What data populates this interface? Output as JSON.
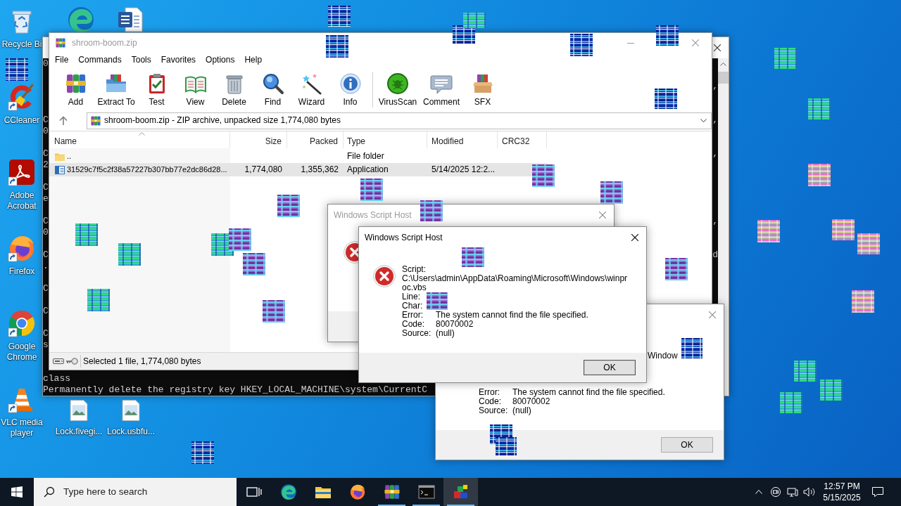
{
  "desktop": {
    "shortcuts": [
      {
        "kind": "recycle-bin",
        "label": "Recycle Bi",
        "shortcut": false
      },
      {
        "kind": "browser",
        "shortcut": false
      },
      {
        "kind": "document",
        "shortcut": false
      },
      {
        "kind": "cleaner",
        "label": "CCleaner",
        "shortcut": true
      },
      {
        "kind": "pdf",
        "label": "Adobe Acrobat",
        "shortcut": true
      },
      {
        "kind": "firefox",
        "label": "Firefox",
        "shortcut": true
      },
      {
        "kind": "chrome",
        "label": "Google Chrome",
        "shortcut": true
      },
      {
        "kind": "vlc",
        "label": "VLC media player",
        "shortcut": true
      },
      {
        "kind": "image",
        "label": "Lock.fivegi...",
        "shortcut": false
      },
      {
        "kind": "image",
        "label": "Lock.usbfu...",
        "shortcut": false
      }
    ]
  },
  "console": {
    "left_fragments": [
      "0",
      "C",
      "0",
      "C",
      "2",
      "C",
      "e",
      "C",
      "0",
      "C",
      ".",
      "C",
      "C",
      "C",
      "s"
    ],
    "right_fragments": [
      ",",
      ",",
      ",",
      ",",
      "d"
    ],
    "lines": [
      "class",
      "Permanently delete the registry key HKEY_LOCAL_MACHINE\\system\\CurrentC"
    ]
  },
  "winrar": {
    "title": "shroom-boom.zip",
    "active": false,
    "menu": [
      "File",
      "Commands",
      "Tools",
      "Favorites",
      "Options",
      "Help"
    ],
    "toolbar": [
      {
        "kind": "add",
        "label": "Add"
      },
      {
        "kind": "extract",
        "label": "Extract To"
      },
      {
        "kind": "test",
        "label": "Test"
      },
      {
        "kind": "view",
        "label": "View"
      },
      {
        "kind": "delete",
        "label": "Delete"
      },
      {
        "kind": "find",
        "label": "Find"
      },
      {
        "kind": "wizard",
        "label": "Wizard"
      },
      {
        "kind": "info",
        "label": "Info"
      },
      {
        "kind": "separator"
      },
      {
        "kind": "virusscan",
        "label": "VirusScan"
      },
      {
        "kind": "comment",
        "label": "Comment"
      },
      {
        "kind": "sfx",
        "label": "SFX"
      }
    ],
    "address": "shroom-boom.zip - ZIP archive, unpacked size 1,774,080 bytes",
    "columns": [
      {
        "label": "Name",
        "sorted": true
      },
      {
        "label": "Size",
        "sorted": false
      },
      {
        "label": "Packed",
        "sorted": false
      },
      {
        "label": "Type",
        "sorted": false
      },
      {
        "label": "Modified",
        "sorted": false
      },
      {
        "label": "CRC32",
        "sorted": false
      }
    ],
    "rows": [
      {
        "kind": "folder",
        "name": "..",
        "type": "File folder",
        "selected": false
      },
      {
        "kind": "application",
        "name": "31529c7f5c2f38a57227b307bb77e2dc86d28...",
        "size": "1,774,080",
        "packed": "1,355,362",
        "type": "Application",
        "modified": "5/14/2025 12:2...",
        "selected": true
      }
    ],
    "status": "Selected 1 file, 1,774,080 bytes"
  },
  "script_error_dialogs": [
    {
      "title": "Windows Script Host",
      "active": false
    },
    {
      "title": "Windows Script Host",
      "active": true,
      "lines": [
        {
          "label": "Script:"
        },
        {
          "text": "C:\\Users\\admin\\AppData\\Roaming\\Microsoft\\Windows\\winpr"
        },
        {
          "text": "oc.vbs"
        },
        {
          "label": "Line:"
        },
        {
          "label": "Char:"
        },
        {
          "label": "Error:",
          "value": "The system cannot find the file specified."
        },
        {
          "label": "Code:",
          "value": "80070002"
        },
        {
          "label": "Source:",
          "value": "(null)"
        }
      ],
      "button": "OK"
    },
    {
      "active": false,
      "lines": [
        {
          "text": "Window"
        },
        {
          "label": "Error:",
          "value": "The system cannot find the file specified."
        },
        {
          "label": "Code:",
          "value": "80070002"
        },
        {
          "label": "Source:",
          "value": "(null)"
        }
      ],
      "button": "OK"
    }
  ],
  "taskbar": {
    "search": {
      "placeholder": "Type here to search"
    },
    "apps": [
      {
        "kind": "task-view",
        "running": false,
        "selected": false
      },
      {
        "kind": "browser",
        "running": false,
        "selected": false
      },
      {
        "kind": "folder",
        "running": false,
        "selected": false
      },
      {
        "kind": "firefox",
        "running": false,
        "selected": false
      },
      {
        "kind": "archiver",
        "running": true,
        "selected": false
      },
      {
        "kind": "console",
        "running": true,
        "selected": false
      },
      {
        "kind": "installer",
        "running": true,
        "selected": true
      }
    ],
    "clock": {
      "time": "12:57 PM",
      "date": "5/15/2025"
    }
  }
}
